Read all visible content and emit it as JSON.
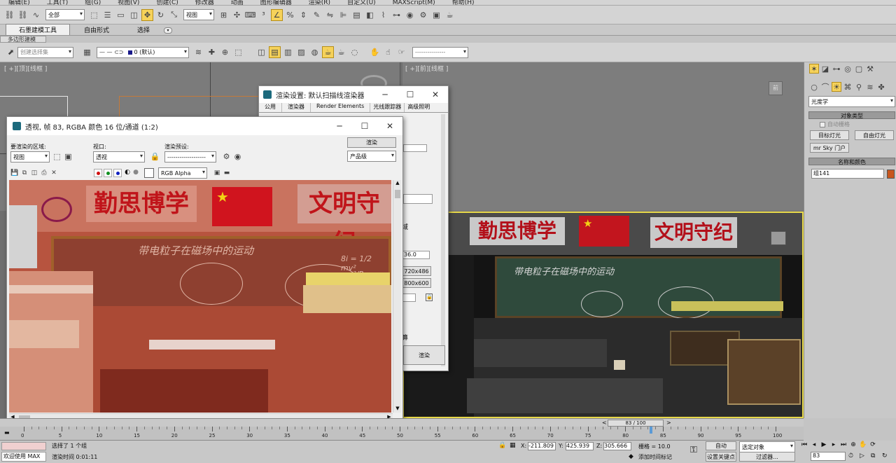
{
  "menubar": [
    "编辑(E)",
    "工具(T)",
    "组(G)",
    "视图(V)",
    "创建(C)",
    "修改器",
    "动画",
    "图形编辑器",
    "渲染(R)",
    "自定义(U)",
    "MAXScript(M)",
    "帮助(H)"
  ],
  "toolbar": {
    "selection_filter": "全部",
    "view_dropdown": "视图",
    "named_selection": "创建选择集",
    "layer_dropdown": "0 (默认)"
  },
  "ribbon": {
    "tabs": [
      "石墨建模工具",
      "自由形式",
      "选择"
    ],
    "subtab": "多边形建模"
  },
  "viewports": {
    "top": "[ +][顶][线框 ]",
    "front": "[ +][前][线框 ]"
  },
  "render_setup": {
    "title": "渲染设置: 默认扫描线渲染器",
    "tabs": [
      "公用",
      "渲染器",
      "Render Elements",
      "光线跟踪器",
      "高级照明"
    ],
    "value_aperture": "36.0",
    "preset_720": "720x486",
    "preset_800": "800x600",
    "area_suffix": "域",
    "bottom_char": "算",
    "render_button": "渲染"
  },
  "frame_window": {
    "title": "透视, 帧 83, RGBA 颜色 16 位/通道 (1:2)",
    "area_label": "要渲染的区域:",
    "area_value": "视图",
    "viewport_label": "视口:",
    "viewport_value": "透视",
    "preset_label": "渲染预设:",
    "preset_value": "-------------------",
    "render_button": "渲染",
    "quality_value": "产品级",
    "channel_value": "RGB Alpha"
  },
  "scene": {
    "banner_left": "勤思博学",
    "banner_right": "文明守纪",
    "chalk_text": "带电粒子在磁场中的运动",
    "formula1": "8i = 1/2 mv²",
    "formula2": "mv²/R"
  },
  "command_panel": {
    "category": "光度学",
    "rollout_object_type": "对象类型",
    "autogrid": "自动栅格",
    "btn_target_light": "目标灯光",
    "btn_free_light": "自由灯光",
    "btn_mr_sky": "mr Sky 门户",
    "rollout_name_color": "名称和颜色",
    "object_name": "组141",
    "object_color": "#c8561d"
  },
  "timeline": {
    "slider_label": "83 / 100",
    "ticks": [
      "0",
      "5",
      "10",
      "15",
      "20",
      "25",
      "30",
      "35",
      "40",
      "45",
      "50",
      "55",
      "60",
      "65",
      "70",
      "75",
      "80",
      "85",
      "90",
      "95",
      "100"
    ]
  },
  "status": {
    "welcome": "欢迎使用 MAX",
    "selection": "选择了 1 个组",
    "render_time": "渲染时间 0:01:11",
    "x_label": "X:",
    "x_value": "-211.809",
    "y_label": "Y:",
    "y_value": "425.939",
    "z_label": "Z:",
    "z_value": "305.666",
    "grid": "栅格 = 10.0",
    "add_time_tag": "添加时间标记",
    "auto_key": "自动",
    "set_key": "设置关键点",
    "selected_objects": "选定对象",
    "filters": "过滤器...",
    "frame": "83"
  }
}
